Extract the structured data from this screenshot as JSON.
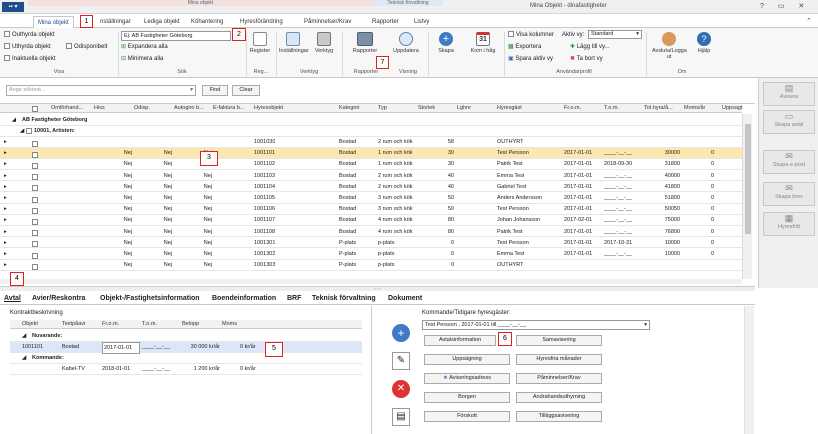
{
  "context_tabs": {
    "left": "Mina objekt",
    "right": "Teknisk förvaltning"
  },
  "window_title": "Mina Objekt - dinafastigheter",
  "ribbon_tabs": [
    "Mina objekt",
    "Inställningar",
    "Lediga objekt",
    "Kö­hantering",
    "Hyresförändring",
    "Påminnelser/Krav",
    "Rapporter",
    "Listvy"
  ],
  "ribbon_tab_labels": {
    "t0": "Mina objekt",
    "t1": "nställningar",
    "t2": "Lediga objekt",
    "t3": "Köhantering",
    "t4": "Hyresförändring",
    "t5": "Påminnelser/Krav",
    "t6": "Rapporter",
    "t7": "Listvy"
  },
  "ribbon": {
    "visa": {
      "label": "Visa",
      "outhyrda": "Outhyrda objekt",
      "uthyrda": "Uthyrda objekt",
      "odisponibelt": "Odisponibelt",
      "inaktuella": "Inaktuella objekt"
    },
    "sok": {
      "label": "Sök",
      "field": "AB Fastigheter Göteborg",
      "expandera": "Expandera alla",
      "minimera": "Minimera alla"
    },
    "reg": {
      "label": "Reg...",
      "register": "Register"
    },
    "verktyg": {
      "label": "Verktyg",
      "installningar": "Inställningar",
      "verktyg": "Verktyg"
    },
    "rapporter": {
      "label": "Rapporter",
      "rapporter": "Rapporter",
      "uppdatera": "Uppdatera"
    },
    "visning": {
      "label": "Visning"
    },
    "skapa": {
      "skapa": "Skapa"
    },
    "kom": {
      "label": "Kom i håg",
      "day": "31"
    },
    "anvandarprofil": {
      "label": "Användarprofil",
      "visa_kolumner": "Visa kolumner",
      "exportera": "Exportera",
      "spara": "Spara aktiv vy",
      "aktiv_vy_label": "Aktiv vy:",
      "aktiv_vy_value": "Standard",
      "lagg_till": "Lägg till vy...",
      "ta_bort": "Ta bort vy"
    },
    "om": {
      "label": "Om",
      "avsluta": "Avsluta/Logga ut",
      "hjalp": "Hjälp"
    }
  },
  "search": {
    "placeholder": "Ange söktext...",
    "find": "Find",
    "clear": "Clear"
  },
  "grid": {
    "columns": [
      "Omförhand...",
      "Hiss",
      "Odisp.",
      "Autogiro b...",
      "E-faktura b...",
      "Hyresobjekt",
      "Kategori",
      "Typ",
      "Storlek",
      "Lghnr",
      "Hyresgäst",
      "Fr.o.m.",
      "T.o.m.",
      "Tot.hyra/å...",
      "Moms/år",
      "Uppsagt"
    ],
    "group1": "AB Fastigheter Göteborg",
    "group2": "10001, Artisten:",
    "rows": [
      [
        "",
        "",
        "",
        "",
        "",
        "1001030",
        "Bostad",
        "2 rum och kök",
        "58",
        "",
        "OUTHYRT",
        "",
        "",
        "",
        "",
        ""
      ],
      [
        "",
        "Nej",
        "Nej",
        "Nej",
        "",
        "1001101",
        "Bostad",
        "1 rum och kök",
        "30",
        "",
        "Test Persson",
        "2017-01-01",
        "____-__-__",
        "30000",
        "0",
        ""
      ],
      [
        "",
        "Nej",
        "Nej",
        "Nej",
        "",
        "1001102",
        "Bostad",
        "1 rum och kök",
        "30",
        "",
        "Patrik Test",
        "2017-01-01",
        "2018-09-30",
        "31800",
        "0",
        ""
      ],
      [
        "",
        "Nej",
        "Nej",
        "Nej",
        "",
        "1001103",
        "Bostad",
        "2 rum och kök",
        "40",
        "",
        "Emma Test",
        "2017-01-01",
        "____-__-__",
        "40000",
        "0",
        ""
      ],
      [
        "",
        "Nej",
        "Nej",
        "Nej",
        "",
        "1001104",
        "Bostad",
        "2 rum och kök",
        "40",
        "",
        "Gabriel Test",
        "2017-01-01",
        "____-__-__",
        "41800",
        "0",
        ""
      ],
      [
        "",
        "Nej",
        "Nej",
        "Nej",
        "",
        "1001105",
        "Bostad",
        "3 rum och kök",
        "50",
        "",
        "Anders Andersson",
        "2017-01-01",
        "____-__-__",
        "51800",
        "0",
        ""
      ],
      [
        "",
        "Nej",
        "Nej",
        "Nej",
        "",
        "1001106",
        "Bostad",
        "3 rum och kök",
        "50",
        "",
        "Test Persson",
        "2017-01-01",
        "____-__-__",
        "50050",
        "0",
        ""
      ],
      [
        "",
        "Nej",
        "Nej",
        "Nej",
        "",
        "1001107",
        "Bostad",
        "4 rum och kök",
        "80",
        "",
        "Johan Johansson",
        "2017-02-01",
        "____-__-__",
        "75000",
        "0",
        ""
      ],
      [
        "",
        "Nej",
        "Nej",
        "Nej",
        "",
        "1001108",
        "Bostad",
        "4 rum och kök",
        "80",
        "",
        "Patrik Test",
        "2017-01-01",
        "____-__-__",
        "76800",
        "0",
        ""
      ],
      [
        "",
        "Nej",
        "Nej",
        "Nej",
        "",
        "1001301",
        "P-plats",
        "p-plats",
        "0",
        "",
        "Test Persson",
        "2017-01-01",
        "2017-10-31",
        "10000",
        "0",
        ""
      ],
      [
        "",
        "Nej",
        "Nej",
        "Nej",
        "",
        "1001302",
        "P-plats",
        "p-plats",
        "0",
        "",
        "Emma Test",
        "2017-01-01",
        "____-__-__",
        "10000",
        "0",
        ""
      ],
      [
        "",
        "Nej",
        "Nej",
        "Nej",
        "",
        "1001303",
        "P-plats",
        "p-plats",
        "0",
        "",
        "OUTHYRT",
        "",
        "",
        "",
        "",
        ""
      ]
    ]
  },
  "side_buttons": [
    "Avisera",
    "Skapa avtal",
    "Skapa e-post",
    "Skapa brev",
    "Hyresfritt"
  ],
  "bottom_tabs": [
    "Avtal",
    "Avier/Reskontra",
    "Objekt-/Fastighetsinformation",
    "Boendeinformation",
    "BRF",
    "Teknisk förvaltning",
    "Dokument"
  ],
  "kontrakt": {
    "title": "Kontraktbeskrivning",
    "columns": [
      "Objekt",
      "Textpåavi",
      "Fr.o.m.",
      "T.o.m.",
      "Belopp",
      "Moms"
    ],
    "nuvarande": "Nuvarande:",
    "row1": {
      "objekt": "1001101",
      "text": "Bostad",
      "from": "2017-01-01",
      "tom": "____-__-__",
      "belopp": "30 000 kr/år",
      "moms": "0 kr/år"
    },
    "kommande": "Kommande:",
    "row2": {
      "objekt": "",
      "text": "Kabel-TV",
      "from": "2018-01-01",
      "tom": "____-__-__",
      "belopp": "1 200 kr/år",
      "moms": "0 kr/år"
    }
  },
  "tenant": {
    "title": "Kommande/Tidigare hyresgäster:",
    "selected": "Test Persson , 2017-01-01 till ____-__-__",
    "buttons": [
      "Avtalsinformation",
      "Samavisering",
      "Uppsägning",
      "Hyresfria månader",
      "Aviseringsadress",
      "Påminnelser/Krav",
      "Borgen",
      "Andrahandsuthyrning",
      "Förskott",
      "Tilläggsavisering"
    ]
  },
  "markers": [
    "1",
    "2",
    "3",
    "4",
    "5",
    "6",
    "7"
  ]
}
